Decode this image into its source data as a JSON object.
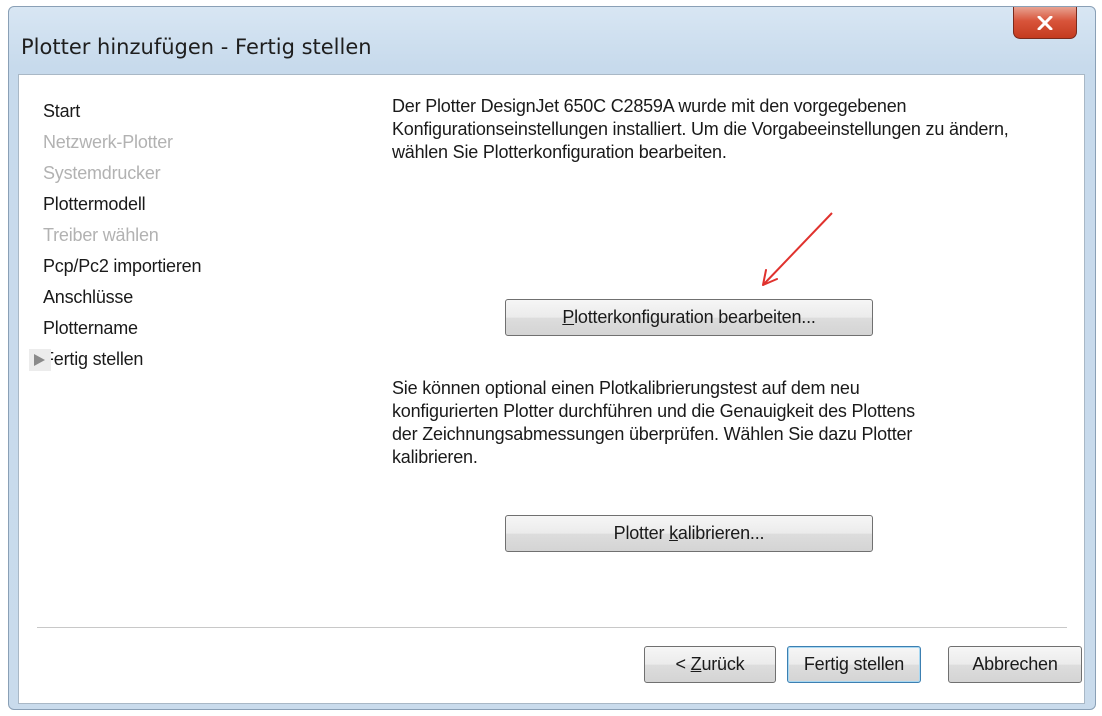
{
  "window": {
    "title": "Plotter hinzufügen - Fertig stellen",
    "close_icon": "close-x-icon"
  },
  "steps": [
    {
      "label": "Start",
      "state": "enabled"
    },
    {
      "label": "Netzwerk-Plotter",
      "state": "disabled"
    },
    {
      "label": "Systemdrucker",
      "state": "disabled"
    },
    {
      "label": "Plottermodell",
      "state": "enabled"
    },
    {
      "label": "Treiber wählen",
      "state": "disabled"
    },
    {
      "label": "Pcp/Pc2 importieren",
      "state": "enabled"
    },
    {
      "label": "Anschlüsse",
      "state": "enabled"
    },
    {
      "label": "Plottername",
      "state": "enabled"
    },
    {
      "label": "Fertig stellen",
      "state": "current"
    }
  ],
  "content": {
    "intro_text": "Der Plotter DesignJet 650C C2859A wurde mit den vorgegebenen Konfigurationseinstellungen installiert. Um die Vorgabeeinstellungen zu ändern, wählen Sie Plotterkonfiguration bearbeiten.",
    "edit_config_button": {
      "accel": "P",
      "rest": "lotterkonfiguration bearbeiten..."
    },
    "calibrate_text": "Sie können optional einen Plotkalibrierungstest auf dem neu konfigurierten Plotter durchführen und die Genauigkeit des Plottens der Zeichnungsabmessungen überprüfen. Wählen Sie dazu Plotter kalibrieren.",
    "calibrate_button": {
      "pre": "Plotter ",
      "accel": "k",
      "rest": "alibrieren..."
    }
  },
  "footer": {
    "back_button": {
      "pre": "< ",
      "accel": "Z",
      "rest": "urück"
    },
    "finish_button": "Fertig stellen",
    "cancel_button": "Abbrechen"
  },
  "colors": {
    "annotation_arrow": "#e0322e",
    "disabled_text": "#b2b2b2"
  }
}
